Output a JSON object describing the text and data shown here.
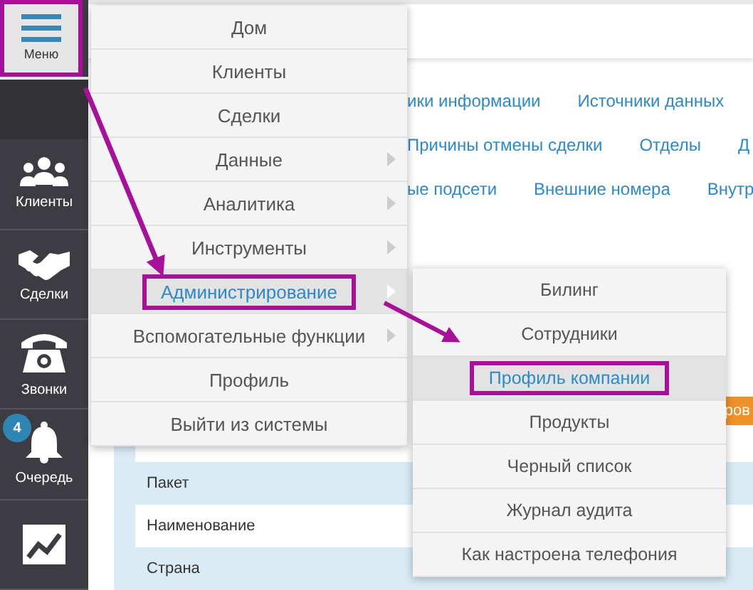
{
  "menu_button": {
    "label": "Меню"
  },
  "sidebar": {
    "items": [
      {
        "kind": "people",
        "label": "Клиенты"
      },
      {
        "kind": "handshake",
        "label": "Сделки"
      },
      {
        "kind": "phone",
        "label": "Звонки"
      },
      {
        "kind": "bell",
        "label": "Очередь",
        "badge": "4"
      },
      {
        "kind": "chart"
      }
    ]
  },
  "header_links": [
    {
      "links": [
        "ики информации",
        "Источники данных"
      ]
    },
    {
      "links": [
        "Причины отмены сделки",
        "Отделы",
        "Д"
      ]
    },
    {
      "links": [
        "ые подсети",
        "Внешние номера",
        "Внутр"
      ]
    }
  ],
  "content": {
    "button": "ров",
    "rows": [
      {
        "label": "Пакет"
      },
      {
        "label": "Наименование"
      },
      {
        "label": "Страна"
      }
    ]
  },
  "main_menu": {
    "items": [
      {
        "label": "Дом",
        "has_submenu": false,
        "selected": false
      },
      {
        "label": "Клиенты",
        "has_submenu": false,
        "selected": false
      },
      {
        "label": "Сделки",
        "has_submenu": false,
        "selected": false
      },
      {
        "label": "Данные",
        "has_submenu": true,
        "selected": false
      },
      {
        "label": "Аналитика",
        "has_submenu": true,
        "selected": false
      },
      {
        "label": "Инструменты",
        "has_submenu": true,
        "selected": false
      },
      {
        "label": "Администрирование",
        "has_submenu": true,
        "selected": true
      },
      {
        "label": "Вспомогательные функции",
        "has_submenu": true,
        "selected": false
      },
      {
        "label": "Профиль",
        "has_submenu": false,
        "selected": false
      },
      {
        "label": "Выйти из системы",
        "has_submenu": false,
        "selected": false
      }
    ]
  },
  "submenu": {
    "items": [
      {
        "label": "Билинг",
        "selected": false
      },
      {
        "label": "Сотрудники",
        "selected": false
      },
      {
        "label": "Профиль компании",
        "selected": true
      },
      {
        "label": "Продукты",
        "selected": false
      },
      {
        "label": "Черный список",
        "selected": false
      },
      {
        "label": "Журнал аудита",
        "selected": false
      },
      {
        "label": "Как настроена телефония",
        "selected": false
      }
    ]
  }
}
